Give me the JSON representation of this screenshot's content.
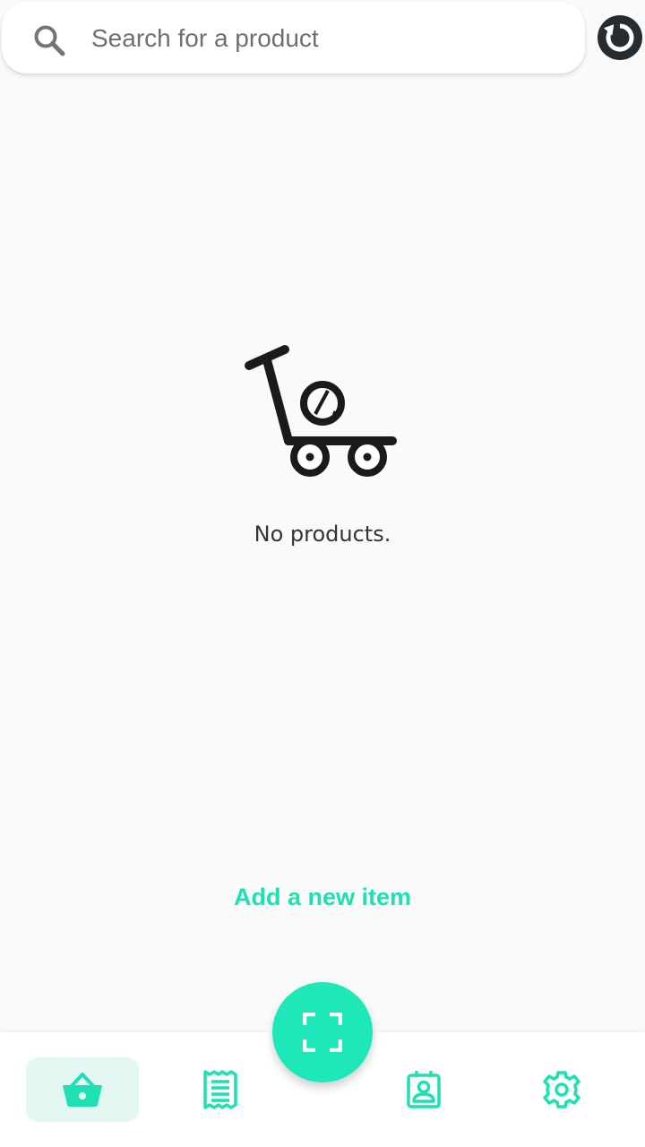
{
  "search": {
    "placeholder": "Search for a product",
    "value": ""
  },
  "icons": {
    "search": "search-icon",
    "refresh": "refresh-icon",
    "empty": "cart-trolley-icon",
    "scan": "scan-icon",
    "basket": "basket-icon",
    "receipt": "receipt-icon",
    "contact": "contact-card-icon",
    "settings": "gear-icon"
  },
  "empty_state": {
    "message": "No products."
  },
  "actions": {
    "add_item_label": "Add a new item"
  },
  "bottom_nav": {
    "items": [
      {
        "id": "basket",
        "active": true
      },
      {
        "id": "receipt",
        "active": false
      },
      {
        "id": "contact",
        "active": false
      },
      {
        "id": "settings",
        "active": false
      }
    ]
  },
  "colors": {
    "accent": "#1ee8b8",
    "accent_text": "#1ee0b3",
    "active_tab_bg": "#e3f8f2",
    "refresh_bg": "#252d33",
    "background": "#fafafa"
  }
}
